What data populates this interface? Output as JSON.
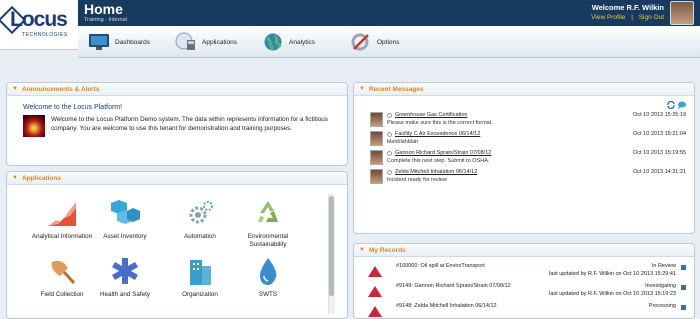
{
  "logo": {
    "name": "Locus",
    "sub": "TECHNOLOGIES"
  },
  "header": {
    "title": "Home",
    "subtitle": "Training - Internal",
    "welcome": "Welcome R.F. Wilkin",
    "view_profile": "View Profile",
    "sign_out": "Sign Out"
  },
  "nav": [
    {
      "label": "Dashboards",
      "icon": "monitor-icon"
    },
    {
      "label": "Applications",
      "icon": "applications-icon"
    },
    {
      "label": "Analytics",
      "icon": "globe-icon"
    },
    {
      "label": "Options",
      "icon": "tools-icon"
    }
  ],
  "announcements": {
    "title": "Announcements & Alerts",
    "heading": "Welcome to the Locus Platform!",
    "body": "Welcome to the Locus Platform Demo system. The data within represents information for a fictitious company. You are welcome to use this tenant for demonstration and training purposes."
  },
  "applications": {
    "title": "Applications",
    "items": [
      {
        "label": "Analytical Information",
        "icon": "analytics-chart-icon",
        "color": "#e8503a"
      },
      {
        "label": "Asset Inventory",
        "icon": "boxes-icon",
        "color": "#3aa6d8"
      },
      {
        "label": "Automation",
        "icon": "gears-icon",
        "color": "#8aa3b8"
      },
      {
        "label": "Environmental Sustainability",
        "icon": "recycle-icon",
        "color": "#8fbf6a"
      },
      {
        "label": "Field Collection",
        "icon": "trowel-icon",
        "color": "#e39a5a"
      },
      {
        "label": "Health and Safety",
        "icon": "medical-icon",
        "color": "#4a6ec8"
      },
      {
        "label": "Organization",
        "icon": "building-icon",
        "color": "#3a9ec8"
      },
      {
        "label": "SWTS",
        "icon": "water-drop-icon",
        "color": "#3a8ed0"
      }
    ]
  },
  "messages": {
    "title": "Recent Messages",
    "items": [
      {
        "subject": "Greenhouse Gas Certification",
        "body": "Please make sure this is the correct format.",
        "date": "Oct 10 2013 15:25:19"
      },
      {
        "subject": "Facility C Air Exceedence 06/14/12",
        "body": "blahblahblah",
        "date": "Oct 10 2013 15:21:04"
      },
      {
        "subject": "Gannon Richard Sprain/Strain 07/08/12",
        "body": "Complete this next step. Submit to OSHA.",
        "date": "Oct 10 2013 15:19:55"
      },
      {
        "subject": "Zelda Mitchell Inhalation 06/14/12",
        "body": "Incident ready for review",
        "date": "Oct 10 2013 14:31:21"
      }
    ]
  },
  "records": {
    "title": "My Records",
    "items": [
      {
        "title": "#100000: Oil spill at EnviroTransport",
        "status": "In Review",
        "updated": "last updated by R.F. Wilkin on Oct 10 2013 15:29:41"
      },
      {
        "title": "#9149: Gannon Richard Sprain/Strain 07/08/12",
        "status": "Investigating",
        "updated": "last updated by R.F. Wilkin on Oct 10 2013 15:19:23"
      },
      {
        "title": "#9148: Zelda Mitchell Inhalation 06/14/12",
        "status": "Processing",
        "updated": ""
      }
    ]
  },
  "colors": {
    "header_bg": "#173a5e",
    "accent": "#e0861a",
    "link": "#1a3b78"
  }
}
